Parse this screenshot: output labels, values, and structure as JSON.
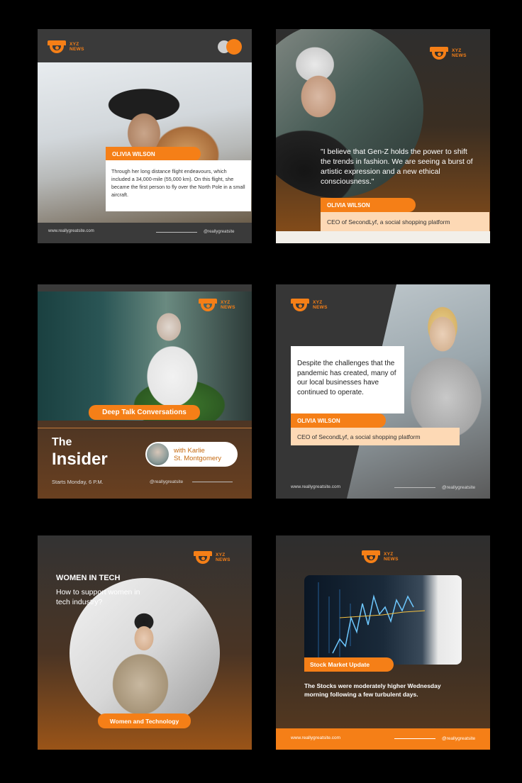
{
  "brand": {
    "logo_line1": "XYZ",
    "logo_line2": "NEWS",
    "accent": "#f57f17",
    "light_accent": "#fdd9b5"
  },
  "card1": {
    "name_label": "OLIVIA WILSON",
    "body": "Through her long distance flight endeavours, which included a 34,000-mile (55,000 km). On this flight, she became the first person to fly over the North Pole in a small aircraft.",
    "website": "www.reallygreatsite.com",
    "handle": "@reallygreatsite"
  },
  "card2": {
    "quote": "\"I believe that Gen-Z holds the power to shift the trends in fashion. We are seeing a burst of artistic expression and a new ethical consciousness.\"",
    "name_label": "OLIVIA WILSON",
    "role": "CEO of SecondLyf, a social shopping platform"
  },
  "card3": {
    "banner": "Deep Talk Conversations",
    "title_line1": "The",
    "title_line2": "Insider",
    "guest_line1": "with Karlie",
    "guest_line2": "St. Montgomery",
    "schedule": "Starts Monday, 6 P.M.",
    "handle": "@reallygreatsite"
  },
  "card4": {
    "body": "Despite the challenges that the pandemic has created, many of our local businesses have continued to operate.",
    "name_label": "OLIVIA WILSON",
    "role": "CEO of SecondLyf, a social shopping platform",
    "website": "www.reallygreatsite.com",
    "handle": "@reallygreatsite"
  },
  "card5": {
    "heading": "WOMEN IN TECH",
    "question": "How to support women in tech industry?",
    "banner": "Women and Technology"
  },
  "card6": {
    "banner": "Stock Market Update",
    "body": "The Stocks were moderately higher Wednesday morning following a few turbulent days.",
    "website": "www.reallygreatsite.com",
    "handle": "@reallygreatsite"
  }
}
